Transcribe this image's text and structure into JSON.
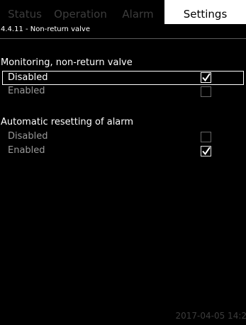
{
  "tabs": [
    "Status",
    "Operation",
    "Alarm",
    "Settings"
  ],
  "breadcrumb": "4.4.11 - Non-return valve",
  "monitoring": {
    "heading": "Monitoring, non-return valve",
    "options": [
      {
        "label": "Disabled",
        "checked": true,
        "selected": true
      },
      {
        "label": "Enabled",
        "checked": false,
        "selected": false
      }
    ]
  },
  "resetting": {
    "heading": "Automatic resetting of alarm",
    "options": [
      {
        "label": "Disabled",
        "checked": false,
        "selected": false
      },
      {
        "label": "Enabled",
        "checked": true,
        "selected": false
      }
    ]
  },
  "footer": "2017-04-05 14:2"
}
